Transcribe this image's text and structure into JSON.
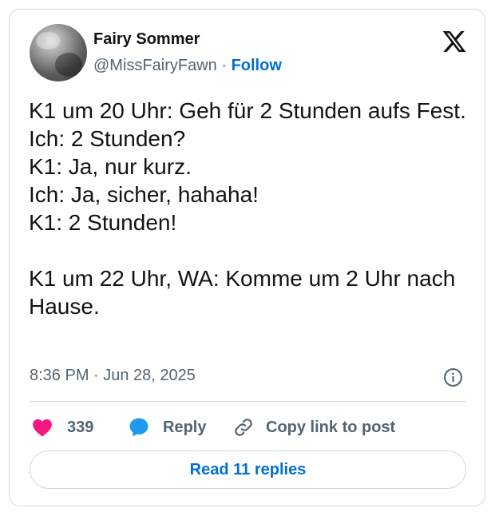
{
  "author": {
    "name": "Fairy Sommer",
    "handle": "@MissFairyFawn",
    "separator": "·",
    "follow_label": "Follow"
  },
  "tweet": {
    "text": "K1 um 20 Uhr: Geh für 2 Stunden aufs Fest.\nIch: 2 Stunden?\nK1: Ja, nur kurz.\nIch: Ja, sicher, hahaha!\nK1: 2 Stunden!\n\nK1 um 22 Uhr, WA: Komme um 2 Uhr nach Hause.",
    "timestamp": "8:36 PM · Jun 28, 2025"
  },
  "actions": {
    "like_count": "339",
    "reply_label": "Reply",
    "copy_label": "Copy link to post"
  },
  "read_replies_label": "Read 11 replies",
  "colors": {
    "accent": "#006fd6",
    "like": "#f91880",
    "reply": "#1d9bf0",
    "secondary_text": "#536471",
    "border": "#cfd9de"
  },
  "icons": {
    "logo": "x-logo-icon",
    "info": "info-icon",
    "like": "heart-icon",
    "reply": "speech-bubble-icon",
    "copy": "link-icon"
  }
}
